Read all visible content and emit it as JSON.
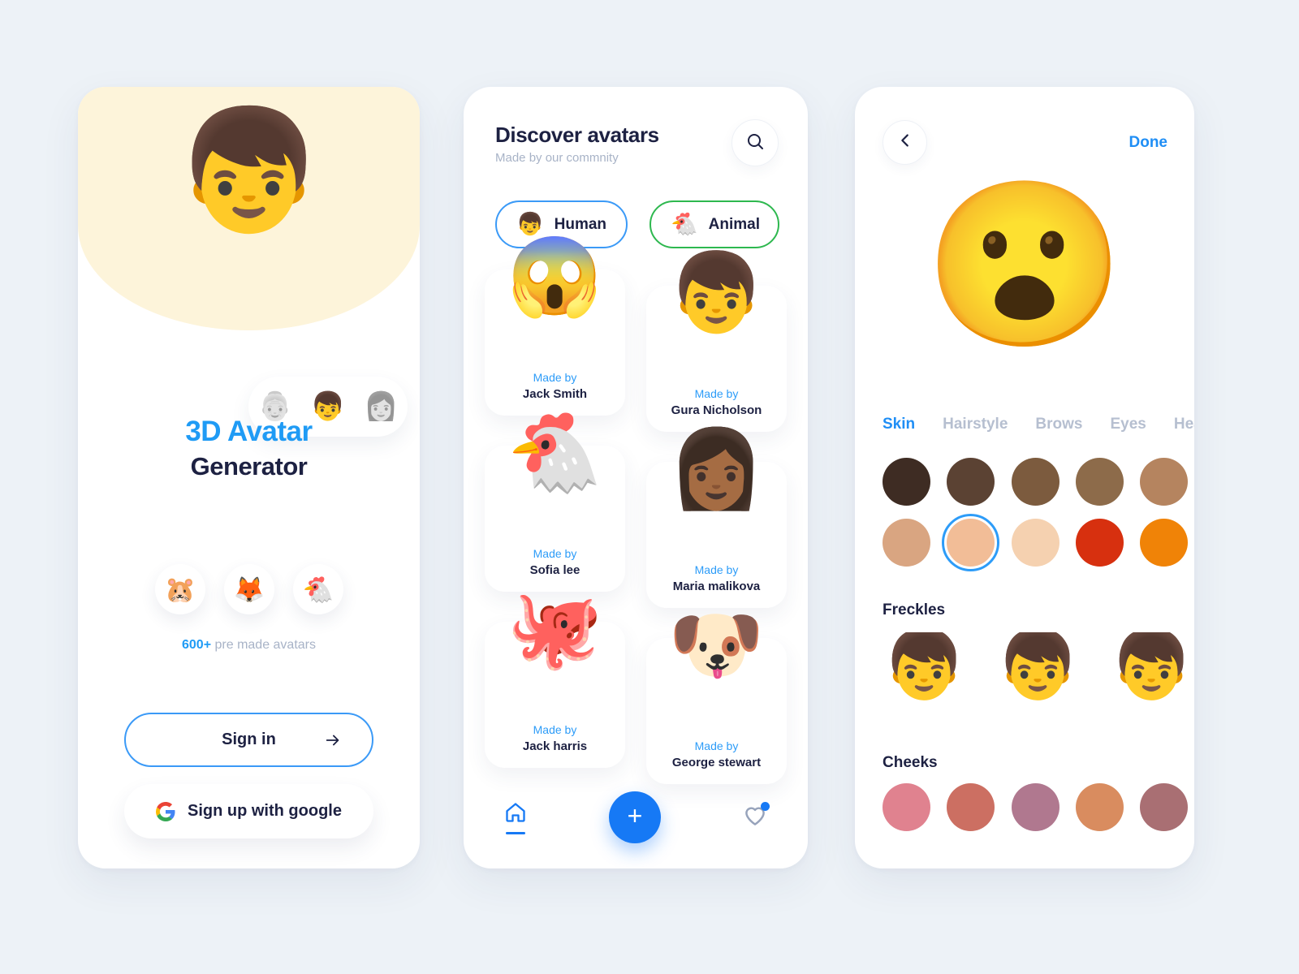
{
  "theme": {
    "background": "#edf2f7",
    "panel_bg": "#ffffff",
    "accent_blue": "#1f9bf5",
    "accent_green": "#2eb84f",
    "cream": "#fdf4da",
    "text_dark": "#1d2142",
    "text_muted": "#a8b3c7"
  },
  "onboarding": {
    "hero_avatar_icon": "boy-avatar-smiling",
    "hero_avatar_glyph": "👦",
    "pill_avatars": [
      {
        "icon": "woman-glasses-avatar",
        "glyph": "👵",
        "dim": true
      },
      {
        "icon": "boy-avatar",
        "glyph": "👦",
        "dim": false
      },
      {
        "icon": "long-hair-woman-avatar",
        "glyph": "👩",
        "dim": true
      }
    ],
    "title_line1": "3D Avatar",
    "title_line2": "Generator",
    "premade_bubbles": [
      {
        "icon": "hamster-avatar",
        "glyph": "🐹"
      },
      {
        "icon": "fox-avatar",
        "glyph": "🦊"
      },
      {
        "icon": "chicken-avatar",
        "glyph": "🐔"
      }
    ],
    "premade_count": "600+",
    "premade_caption": " pre made avatars",
    "signin_label": "Sign in",
    "signin_arrow_icon": "arrow-right-icon",
    "google_label": "Sign up with google",
    "google_icon": "google-g-icon"
  },
  "discover": {
    "title": "Discover avatars",
    "subtitle": "Made by our commnity",
    "search_icon": "search-icon",
    "filters": [
      {
        "label": "Human",
        "icon": "boy-avatar",
        "glyph": "👦",
        "border": "#3b9af7",
        "selected": true
      },
      {
        "label": "Animal",
        "icon": "chicken-avatar",
        "glyph": "🐔",
        "border": "#2eb84f",
        "selected": false
      }
    ],
    "made_by_label": "Made by",
    "cards": [
      {
        "icon": "surprised-girl-avatar",
        "glyph": "😱",
        "author": "Jack Smith"
      },
      {
        "icon": "boy-avatar",
        "glyph": "👦",
        "author": "Gura Nicholson"
      },
      {
        "icon": "chicken-avatar",
        "glyph": "🐔",
        "author": "Sofia lee"
      },
      {
        "icon": "long-hair-woman-avatar",
        "glyph": "👩🏾",
        "author": "Maria malikova"
      },
      {
        "icon": "octopus-avatar",
        "glyph": "🐙",
        "author": "Jack harris"
      },
      {
        "icon": "dog-avatar",
        "glyph": "🐶",
        "author": "George stewart"
      }
    ],
    "nav": [
      {
        "icon": "home-icon",
        "name": "nav-home",
        "active": true,
        "badge": false
      },
      {
        "icon": "plus-icon",
        "name": "nav-add",
        "active": false,
        "badge": false
      },
      {
        "icon": "heart-icon",
        "name": "nav-favorites",
        "active": false,
        "badge": true
      }
    ]
  },
  "editor": {
    "back_icon": "chevron-left-icon",
    "done_label": "Done",
    "preview_icon": "boy-avatar-surprised",
    "preview_glyph": "😮",
    "tabs": [
      {
        "label": "Skin",
        "active": true
      },
      {
        "label": "Hairstyle",
        "active": false
      },
      {
        "label": "Brows",
        "active": false
      },
      {
        "label": "Eyes",
        "active": false
      },
      {
        "label": "Head",
        "active": false
      }
    ],
    "skin_swatches_row1": [
      "#3e2c23",
      "#5b4233",
      "#7c5b3e",
      "#8d6b4a",
      "#b5845f"
    ],
    "skin_swatches_row2": [
      "#d9a581",
      "#f2bd97",
      "#f5d1b0",
      "#d7300f",
      "#f08307"
    ],
    "skin_selected_index": 6,
    "freckles_title": "Freckles",
    "freckles_options": [
      {
        "icon": "face-no-freckles",
        "glyph": "👦"
      },
      {
        "icon": "face-light-freckles",
        "glyph": "👦"
      },
      {
        "icon": "face-heavy-freckles",
        "glyph": "👦"
      }
    ],
    "cheeks_title": "Cheeks",
    "cheeks_swatches": [
      "#e0828f",
      "#cc6f62",
      "#b0788f",
      "#d98c5f",
      "#a96f73"
    ]
  }
}
